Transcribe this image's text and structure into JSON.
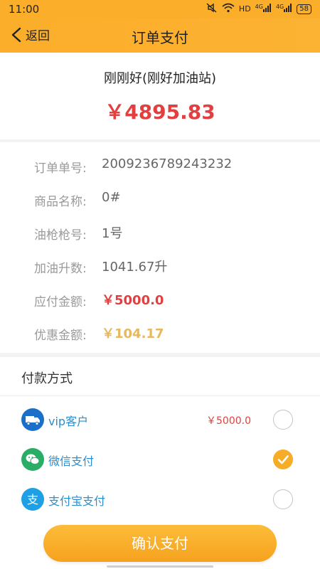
{
  "status_bar": {
    "time": "11:00",
    "indicators": [
      "HD",
      "4G",
      "4G"
    ],
    "battery": "58"
  },
  "nav": {
    "back_label": "返回",
    "title": "订单支付"
  },
  "summary": {
    "station_name": "刚刚好(刚好加油站)",
    "total_amount": "￥4895.83"
  },
  "details": [
    {
      "label": "订单单号:",
      "value": "2009236789243232",
      "style": "normal"
    },
    {
      "label": "商品名称:",
      "value": "0#",
      "style": "normal"
    },
    {
      "label": "油枪枪号:",
      "value": "1号",
      "style": "normal"
    },
    {
      "label": "加油升数:",
      "value": "1041.67升",
      "style": "normal"
    },
    {
      "label": "应付金额:",
      "value": "￥5000.0",
      "style": "red"
    },
    {
      "label": "优惠金额:",
      "value": "￥104.17",
      "style": "gold"
    }
  ],
  "payment": {
    "title": "付款方式",
    "methods": [
      {
        "label": "vip客户",
        "extra": "￥5000.0",
        "icon": "truck-icon",
        "color": "#1a6fc9",
        "checked": false
      },
      {
        "label": "微信支付",
        "extra": "",
        "icon": "wechat-icon",
        "color": "#2aae67",
        "checked": true
      },
      {
        "label": "支付宝支付",
        "extra": "",
        "icon": "alipay-icon",
        "color": "#1da0e6",
        "checked": false
      }
    ]
  },
  "confirm_label": "确认支付",
  "colors": {
    "accent": "#fbae2a",
    "price_red": "#e24040",
    "discount_gold": "#e8b85b",
    "check_orange": "#f6ac26"
  }
}
